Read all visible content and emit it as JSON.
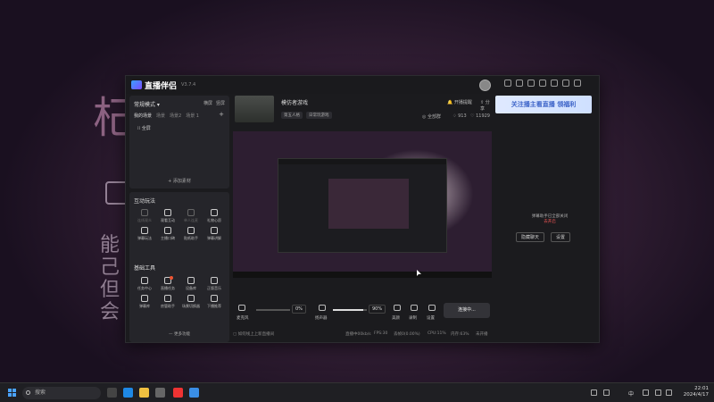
{
  "background": {
    "big_char": "杞",
    "lines": [
      "能 ♀",
      "己 ‖",
      "但 ‖",
      "会 ‖"
    ]
  },
  "app": {
    "name": "直播伴侣",
    "version": "V3.7.4"
  },
  "promo_banner": "关注播主看直播 领福利",
  "scene_panel": {
    "mode": "常规模式 ▾",
    "mode_options": [
      "横屏",
      "竖屏"
    ],
    "tabs": [
      "我的场景",
      "场景",
      "场景2",
      "场景 1"
    ],
    "scene_item": "全屏",
    "add_source": "+ 添加素材"
  },
  "interaction": {
    "title": "互动玩法",
    "items": [
      {
        "label": "连线观众",
        "dim": true
      },
      {
        "label": "观看互动",
        "dim": false
      },
      {
        "label": "单人连麦",
        "dim": true
      },
      {
        "label": "礼物心愿",
        "dim": false
      },
      {
        "label": "弹幕玩法",
        "dim": false
      },
      {
        "label": "主播口碑",
        "dim": false
      },
      {
        "label": "贴纸助手",
        "dim": false
      },
      {
        "label": "弹幕讲解",
        "dim": false
      }
    ]
  },
  "basic_tools": {
    "title": "基础工具",
    "items": [
      "任务中心",
      "直播任务",
      "设备库",
      "正版音乐",
      "弹幕库",
      "房管助手",
      "场景切换器",
      "下播推荐"
    ],
    "more": "— 更多功能"
  },
  "stream": {
    "title": "模仿者游戏",
    "tags": [
      "第五人格",
      "日常玩游戏"
    ],
    "start_live": "开播提醒",
    "share": "分享",
    "fans_group": "全部群",
    "likes": "913",
    "viewers": "11929"
  },
  "controls": {
    "mic_label": "麦克风",
    "mic_pct": "0%",
    "mic_level": 0.0,
    "speaker_label": "扬声器",
    "speaker_pct": "90%",
    "speaker_level": 0.9,
    "beauty": "美颜",
    "record": "录制",
    "settings": "设置",
    "go_live": "连接中..."
  },
  "status_bar": {
    "hint": "如何线上上新直播间",
    "items": [
      "直播中00kb/s",
      "FPS:30",
      "丢帧0(0.00%)",
      "CPU:11%",
      "内存:63%",
      "未开播"
    ]
  },
  "right_panel": {
    "empty_text": "弹幕助手已全部关闭",
    "link": "去开启",
    "btn1": "隐藏聊天",
    "btn2": "设置"
  },
  "taskbar": {
    "search_placeholder": "搜索",
    "time": "22:01",
    "date": "2024/4/17",
    "ime": "中"
  }
}
